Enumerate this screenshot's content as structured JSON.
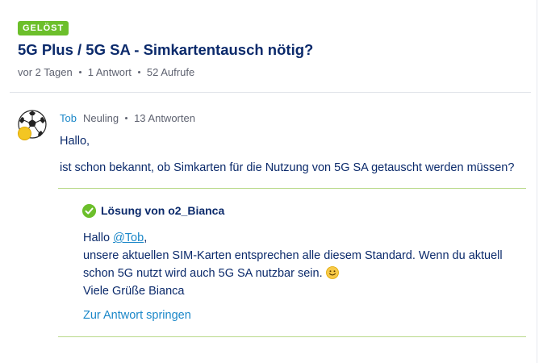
{
  "post": {
    "status_badge": "GELÖST",
    "title": "5G Plus / 5G SA - Simkartentausch nötig?",
    "meta": {
      "age": "vor 2 Tagen",
      "answers": "1 Antwort",
      "views": "52 Aufrufe"
    }
  },
  "question": {
    "author": "Tob",
    "rank": "Neuling",
    "author_answers": "13 Antworten",
    "greeting": "Hallo,",
    "text": "ist schon bekannt, ob Simkarten für die Nutzung von 5G SA getauscht werden müssen?"
  },
  "solution": {
    "header": "Lösung von o2_Bianca",
    "greeting_prefix": "Hallo ",
    "mention": "@Tob",
    "greeting_suffix": ",",
    "line1": "unsere aktuellen SIM-Karten entsprechen alle diesem Standard. Wenn du aktuell",
    "line2": "schon 5G nutzt wird auch 5G SA nutzbar sein.",
    "signoff": "Viele Grüße Bianca",
    "jump_link": "Zur Antwort springen"
  },
  "colors": {
    "accent_green": "#6cbf2b",
    "link_blue": "#1a87c8",
    "text_navy": "#0b2a6b",
    "meta_grey": "#5e6270"
  },
  "icons": {
    "avatar": "soccer-ball-avatar",
    "rank": "rank-badge-icon",
    "solved": "check-circle-icon",
    "emoji": "smiley-icon"
  }
}
